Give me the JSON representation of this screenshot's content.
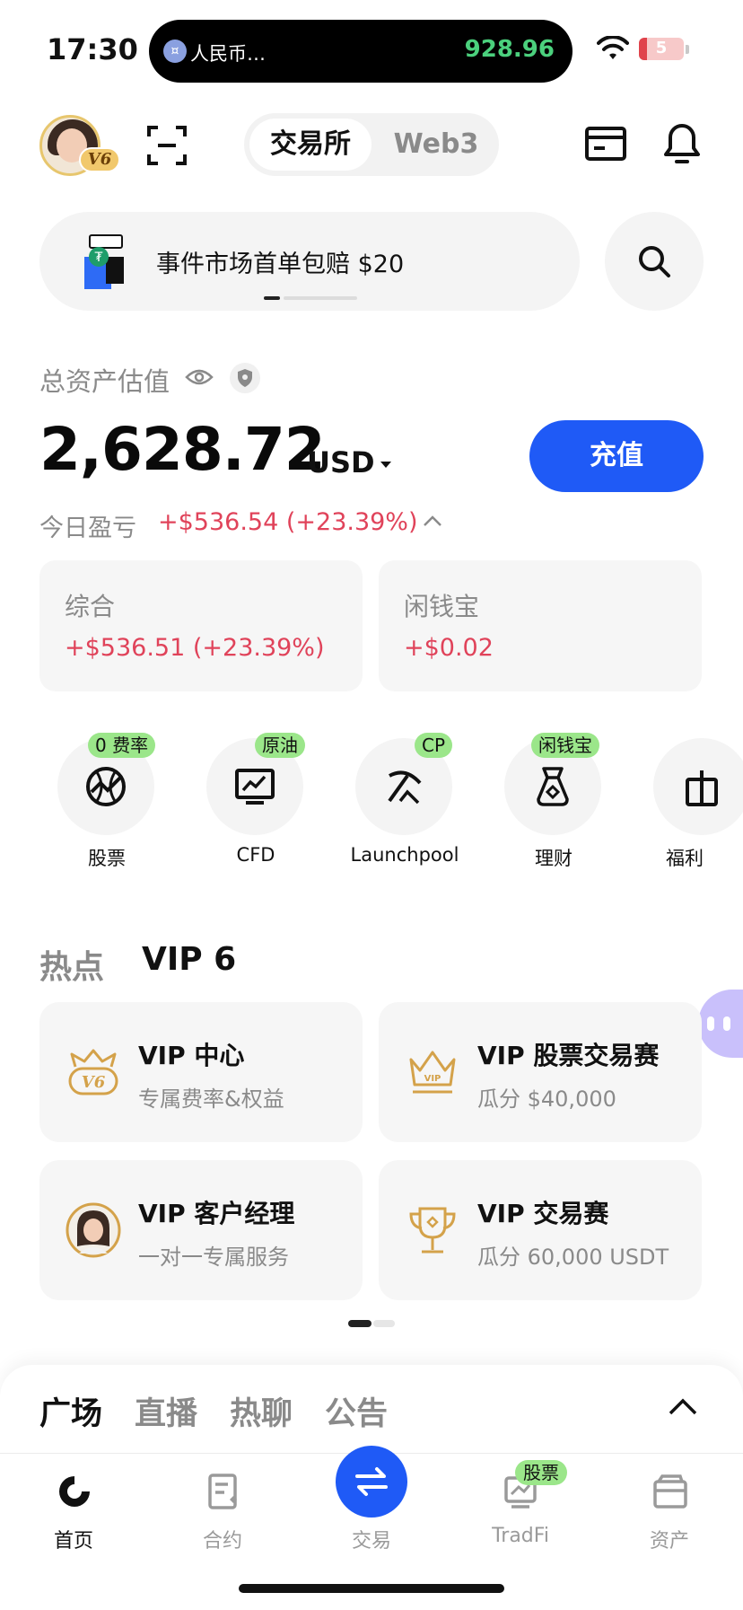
{
  "status_bar": {
    "time": "17:30",
    "island_label": "人民币…",
    "island_value": "928.96",
    "battery": "5"
  },
  "header": {
    "vip_tag": "V6",
    "segment_active": "交易所",
    "segment_other": "Web3"
  },
  "banner": {
    "text": "事件市场首单包赔 $20"
  },
  "assets": {
    "label": "总资产估值",
    "total": "2,628.72",
    "currency": "USD",
    "deposit_label": "充值",
    "pnl_label": "今日盈亏",
    "pnl_value": "+$536.54 (+23.39%)",
    "cards": [
      {
        "title": "综合",
        "value": "+$536.51 (+23.39%)"
      },
      {
        "title": "闲钱宝",
        "value": "+$0.02"
      }
    ]
  },
  "shortcuts": [
    {
      "label": "股票",
      "badge": "0 费率",
      "icon": "stock-globe-icon"
    },
    {
      "label": "CFD",
      "badge": "原油",
      "icon": "chart-monitor-icon"
    },
    {
      "label": "Launchpool",
      "badge": "CP",
      "icon": "pickaxe-icon"
    },
    {
      "label": "理财",
      "badge": "闲钱宝",
      "icon": "money-bag-icon"
    },
    {
      "label": "福利",
      "badge": "",
      "icon": "gift-icon"
    }
  ],
  "hot_section": {
    "tab_hot": "热点",
    "tab_vip": "VIP 6",
    "cards": [
      {
        "title": "VIP 中心",
        "subtitle": "专属费率&权益",
        "icon": "v6-crown-icon"
      },
      {
        "title": "VIP 股票交易赛",
        "subtitle": "瓜分 $40,000",
        "icon": "crown-icon"
      },
      {
        "title": "VIP 客户经理",
        "subtitle": "一对一专属服务",
        "icon": "manager-avatar-icon"
      },
      {
        "title": "VIP 交易赛",
        "subtitle": "瓜分 60,000 USDT",
        "icon": "trophy-icon"
      }
    ]
  },
  "feed_tabs": [
    "广场",
    "直播",
    "热聊",
    "公告"
  ],
  "bottom_nav": {
    "items": [
      {
        "label": "首页",
        "icon": "home-icon"
      },
      {
        "label": "合约",
        "icon": "contract-icon"
      },
      {
        "label": "交易",
        "icon": "trade-arrows-icon"
      },
      {
        "label": "TradFi",
        "icon": "tradfi-icon"
      },
      {
        "label": "资产",
        "icon": "wallet-icon"
      }
    ],
    "tradfi_badge": "股票"
  },
  "colors": {
    "accent_blue": "#1f5af6",
    "profit_red": "#e0435a",
    "badge_green": "#9be68a",
    "gold": "#d4a24a",
    "island_green": "#4bd07d"
  }
}
